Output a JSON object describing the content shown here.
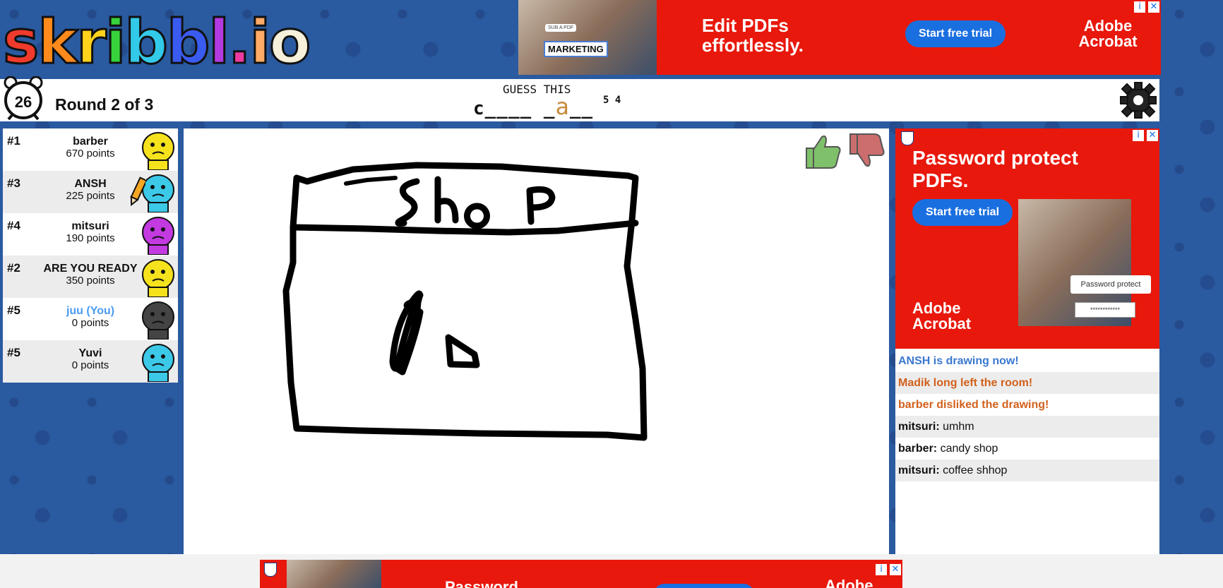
{
  "logo": {
    "text": "skribbl.io!",
    "letters": [
      {
        "ch": "s",
        "color": "#f03a2c"
      },
      {
        "ch": "k",
        "color": "#ff8a1c"
      },
      {
        "ch": "r",
        "color": "#ffd21c"
      },
      {
        "ch": "i",
        "color": "#36d33a"
      },
      {
        "ch": "b",
        "color": "#33c9e8"
      },
      {
        "ch": "b",
        "color": "#3a5bf0"
      },
      {
        "ch": "l",
        "color": "#b33ae0"
      },
      {
        "ch": ".",
        "color": "#f03aa0"
      },
      {
        "ch": "i",
        "color": "#ffaa66"
      },
      {
        "ch": "o",
        "color": "#f7f1dc"
      },
      {
        "ch": "!",
        "color": "#ffffff"
      }
    ]
  },
  "ad_top": {
    "headline": "Edit PDFs effortlessly.",
    "cta": "Start free trial",
    "brand": "Adobe Acrobat",
    "tag": "MARKETING",
    "small_tag": "SUB A PDF"
  },
  "ad_right": {
    "headline": "Password protect PDFs.",
    "cta": "Start free trial",
    "brand": "Adobe Acrobat",
    "field_label": "Password protect",
    "field_value": "************"
  },
  "ad_bottom": {
    "headline": "Password",
    "brand": "Adobe"
  },
  "game": {
    "timer": "26",
    "round": "Round 2 of 3",
    "guess_label": "GUESS THIS",
    "word_pre": "c____ _",
    "word_hint": "a",
    "word_post": "__",
    "word_lengths": "5 4"
  },
  "players": [
    {
      "rank": "#1",
      "name": "barber",
      "points": "670 points",
      "color": "#f5e21c",
      "you": false,
      "drawing": false
    },
    {
      "rank": "#3",
      "name": "ANSH",
      "points": "225 points",
      "color": "#3cc9e8",
      "you": false,
      "drawing": true
    },
    {
      "rank": "#4",
      "name": "mitsuri",
      "points": "190 points",
      "color": "#c23ae0",
      "you": false,
      "drawing": false
    },
    {
      "rank": "#2",
      "name": "ARE YOU READY",
      "points": "350 points",
      "color": "#f5e21c",
      "you": false,
      "drawing": false
    },
    {
      "rank": "#5",
      "name": "juu (You)",
      "points": "0 points",
      "color": "#444444",
      "you": true,
      "drawing": false
    },
    {
      "rank": "#5",
      "name": "Yuvi",
      "points": "0 points",
      "color": "#3cc9e8",
      "you": false,
      "drawing": false
    }
  ],
  "drawing": {
    "text": "Shop"
  },
  "chat": [
    {
      "type": "sys-blue",
      "text": "ANSH is drawing now!"
    },
    {
      "type": "sys-orange",
      "text": "Madik long left the room!"
    },
    {
      "type": "sys-orange",
      "text": "barber disliked the drawing!"
    },
    {
      "type": "msg",
      "name": "mitsuri:",
      "text": " umhm"
    },
    {
      "type": "msg",
      "name": "barber:",
      "text": " candy shop"
    },
    {
      "type": "msg",
      "name": "mitsuri:",
      "text": " coffee shhop"
    }
  ],
  "colors": {
    "background": "#2a5aa0",
    "ad_red": "#e8180c",
    "cta_blue": "#1a6fe0",
    "hint": "#c88a3a",
    "you": "#4a9bf0"
  }
}
